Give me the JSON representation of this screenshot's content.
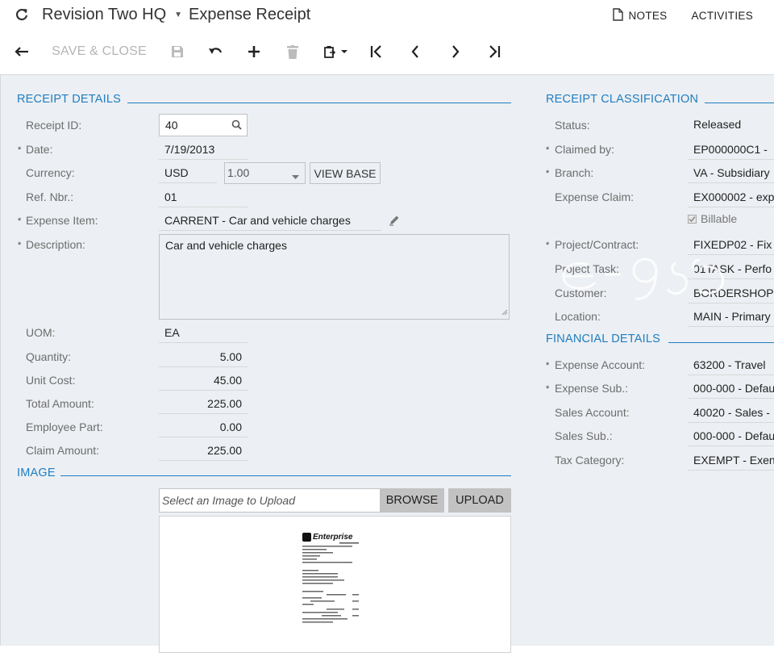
{
  "header": {
    "company": "Revision Two HQ",
    "screen_title": "Expense Receipt",
    "notes_label": "NOTES",
    "activities_label": "ACTIVITIES"
  },
  "toolbar": {
    "save_close_label": "SAVE & CLOSE"
  },
  "receipt_details": {
    "section_title": "RECEIPT DETAILS",
    "receipt_id": {
      "label": "Receipt ID:",
      "value": "40"
    },
    "date": {
      "label": "Date:",
      "value": "7/19/2013"
    },
    "currency": {
      "label": "Currency:",
      "value": "USD",
      "rate": "1.00",
      "view_base_label": "VIEW BASE"
    },
    "ref_nbr": {
      "label": "Ref. Nbr.:",
      "value": "01"
    },
    "expense_item": {
      "label": "Expense Item:",
      "value": "CARRENT - Car and vehicle charges"
    },
    "description": {
      "label": "Description:",
      "value": "Car and vehicle charges"
    },
    "uom": {
      "label": "UOM:",
      "value": "EA"
    },
    "quantity": {
      "label": "Quantity:",
      "value": "5.00"
    },
    "unit_cost": {
      "label": "Unit Cost:",
      "value": "45.00"
    },
    "total_amount": {
      "label": "Total Amount:",
      "value": "225.00"
    },
    "employee_part": {
      "label": "Employee Part:",
      "value": "0.00"
    },
    "claim_amount": {
      "label": "Claim Amount:",
      "value": "225.00"
    }
  },
  "image": {
    "section_title": "IMAGE",
    "upload_placeholder": "Select an Image to Upload",
    "browse_label": "BROWSE",
    "upload_label": "UPLOAD",
    "receipt_brand": "Enterprise"
  },
  "receipt_classification": {
    "section_title": "RECEIPT CLASSIFICATION",
    "status": {
      "label": "Status:",
      "value": "Released"
    },
    "claimed_by": {
      "label": "Claimed by:",
      "value": "EP000000C1 -"
    },
    "branch": {
      "label": "Branch:",
      "value": "VA - Subsidiary"
    },
    "expense_claim": {
      "label": "Expense Claim:",
      "value": "EX000002 - exp"
    },
    "billable": {
      "label": "Billable",
      "checked": true
    },
    "project_contract": {
      "label": "Project/Contract:",
      "value": "FIXEDP02 - Fix"
    },
    "project_task": {
      "label": "Project Task:",
      "value": "01TASK - Perfo"
    },
    "customer": {
      "label": "Customer:",
      "value": "BORDERSHOP"
    },
    "location": {
      "label": "Location:",
      "value": "MAIN - Primary"
    }
  },
  "financial_details": {
    "section_title": "FINANCIAL DETAILS",
    "expense_account": {
      "label": "Expense Account:",
      "value": "63200 - Travel"
    },
    "expense_sub": {
      "label": "Expense Sub.:",
      "value": "000-000 - Defau"
    },
    "sales_account": {
      "label": "Sales Account:",
      "value": "40020 - Sales -"
    },
    "sales_sub": {
      "label": "Sales Sub.:",
      "value": "000-000 - Defau"
    },
    "tax_category": {
      "label": "Tax Category:",
      "value": "EXEMPT - Exen"
    }
  },
  "colors": {
    "accent": "#1f7ec1",
    "panel_background": "#eceff3",
    "button_gray": "#c2c2c2"
  }
}
